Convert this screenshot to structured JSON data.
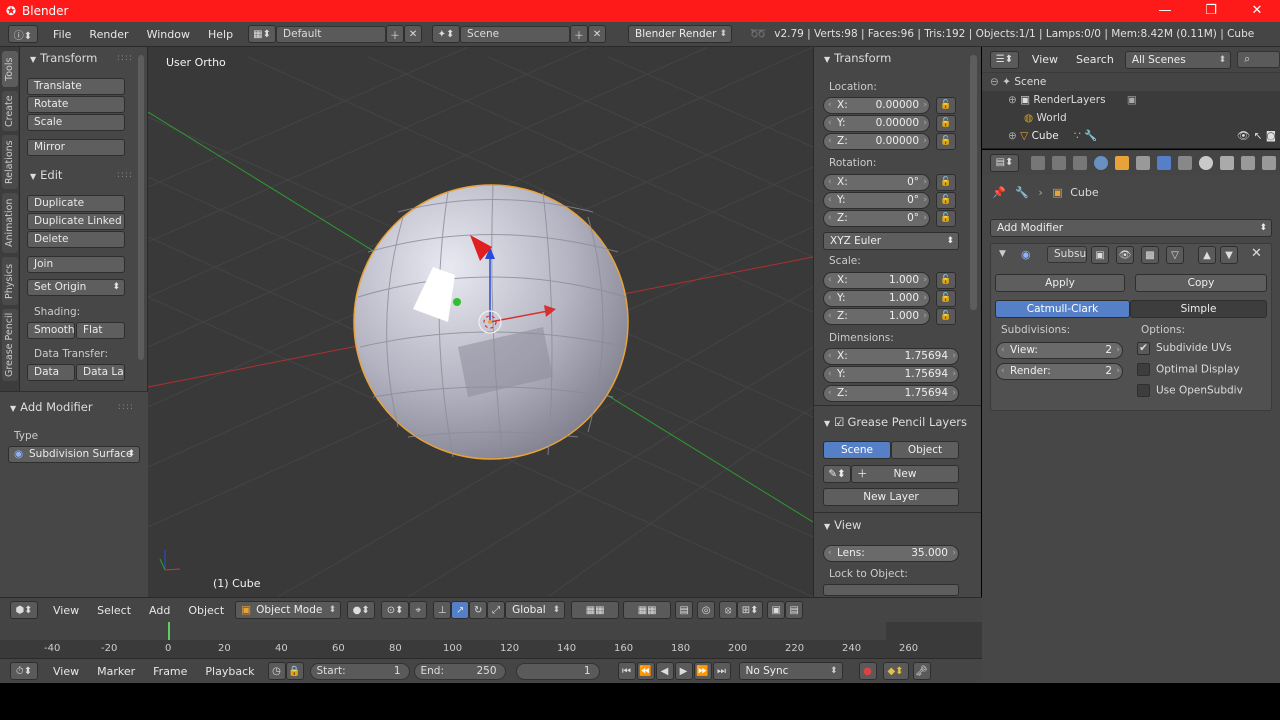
{
  "window": {
    "app_name": "Blender",
    "minimize": "—",
    "maximize": "❐",
    "close": "✕"
  },
  "info_header": {
    "menus": [
      "File",
      "Render",
      "Window",
      "Help"
    ],
    "screen_layout": "Default",
    "scene": "Scene",
    "render_engine": "Blender Render",
    "stats": "v2.79 | Verts:98 | Faces:96 | Tris:192 | Objects:1/1 | Lamps:0/0 | Mem:8.42M (0.11M) | Cube"
  },
  "tool_tabs": [
    "Tools",
    "Create",
    "Relations",
    "Animation",
    "Physics",
    "Grease Pencil"
  ],
  "tool_shelf": {
    "transform": {
      "title": "Transform",
      "buttons": [
        "Translate",
        "Rotate",
        "Scale",
        "Mirror"
      ]
    },
    "edit": {
      "title": "Edit",
      "buttons": [
        "Duplicate",
        "Duplicate Linked",
        "Delete",
        "Join"
      ],
      "set_origin": "Set Origin",
      "shading_label": "Shading:",
      "smooth": "Smooth",
      "flat": "Flat",
      "data_transfer_label": "Data Transfer:",
      "data": "Data",
      "data_la": "Data La"
    },
    "add_modifier": {
      "title": "Add Modifier",
      "type_label": "Type",
      "type_value": "Subdivision Surface"
    }
  },
  "viewport": {
    "view_label": "User Ortho",
    "object_label": "(1) Cube"
  },
  "n_panel": {
    "transform_title": "Transform",
    "location_label": "Location:",
    "location": [
      {
        "axis": "X:",
        "value": "0.00000"
      },
      {
        "axis": "Y:",
        "value": "0.00000"
      },
      {
        "axis": "Z:",
        "value": "0.00000"
      }
    ],
    "rotation_label": "Rotation:",
    "rotation": [
      {
        "axis": "X:",
        "value": "0°"
      },
      {
        "axis": "Y:",
        "value": "0°"
      },
      {
        "axis": "Z:",
        "value": "0°"
      }
    ],
    "rotation_mode": "XYZ Euler",
    "scale_label": "Scale:",
    "scale": [
      {
        "axis": "X:",
        "value": "1.000"
      },
      {
        "axis": "Y:",
        "value": "1.000"
      },
      {
        "axis": "Z:",
        "value": "1.000"
      }
    ],
    "dimensions_label": "Dimensions:",
    "dimensions": [
      {
        "axis": "X:",
        "value": "1.75694"
      },
      {
        "axis": "Y:",
        "value": "1.75694"
      },
      {
        "axis": "Z:",
        "value": "1.75694"
      }
    ],
    "grease_pencil_title": "Grease Pencil Layers",
    "gp_scene": "Scene",
    "gp_object": "Object",
    "gp_new": "New",
    "gp_new_layer": "New Layer",
    "view_title": "View",
    "lens_label": "Lens:",
    "lens_value": "35.000",
    "lock_to_object_label": "Lock to Object:"
  },
  "outliner": {
    "view": "View",
    "search": "Search",
    "filter": "All Scenes",
    "rows": [
      "Scene",
      "RenderLayers",
      "World",
      "Cube"
    ]
  },
  "properties": {
    "object_name": "Cube",
    "add_modifier": "Add Modifier",
    "modifier_name": "Subsu",
    "apply": "Apply",
    "copy": "Copy",
    "catmull_clark": "Catmull-Clark",
    "simple": "Simple",
    "subdivisions_label": "Subdivisions:",
    "view_label": "View:",
    "view_value": "2",
    "render_label": "Render:",
    "render_value": "2",
    "options_label": "Options:",
    "options": [
      {
        "label": "Subdivide UVs",
        "checked": true
      },
      {
        "label": "Optimal Display",
        "checked": false
      },
      {
        "label": "Use OpenSubdiv",
        "checked": false
      }
    ]
  },
  "viewport_header": {
    "menus": [
      "View",
      "Select",
      "Add",
      "Object"
    ],
    "mode": "Object Mode",
    "orientation": "Global"
  },
  "timeline": {
    "ticks": [
      "-40",
      "-20",
      "0",
      "20",
      "40",
      "60",
      "80",
      "100",
      "120",
      "140",
      "160",
      "180",
      "200",
      "220",
      "240",
      "260"
    ],
    "menus": [
      "View",
      "Marker",
      "Frame",
      "Playback"
    ],
    "start_label": "Start:",
    "start_value": "1",
    "end_label": "End:",
    "end_value": "250",
    "current_frame": "1",
    "sync": "No Sync"
  },
  "colors": {
    "title_bar": "#ff1a1a",
    "active_blue": "#5580c8",
    "selection_outline": "#e8a23a",
    "x_axis": "#c03030",
    "y_axis": "#2e9a2e"
  }
}
